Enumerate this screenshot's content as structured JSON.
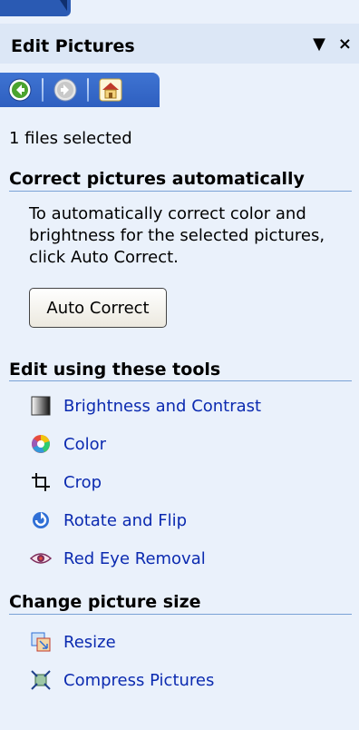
{
  "panel": {
    "title": "Edit Pictures",
    "dropdown_glyph": "▼",
    "close_glyph": "×"
  },
  "nav": {
    "back_icon": "back-arrow-icon",
    "forward_icon": "forward-arrow-icon",
    "home_icon": "home-icon"
  },
  "status": {
    "files_selected": "1 files selected"
  },
  "correct_section": {
    "heading": "Correct pictures automatically",
    "description": "To automatically correct color and brightness for the selected pictures, click Auto Correct.",
    "button_label": "Auto Correct"
  },
  "tools_section": {
    "heading": "Edit using these tools",
    "items": [
      {
        "label": "Brightness and Contrast",
        "icon": "brightness-contrast-icon"
      },
      {
        "label": "Color",
        "icon": "color-wheel-icon"
      },
      {
        "label": "Crop",
        "icon": "crop-icon"
      },
      {
        "label": "Rotate and Flip",
        "icon": "rotate-icon"
      },
      {
        "label": "Red Eye Removal",
        "icon": "eye-icon"
      }
    ]
  },
  "size_section": {
    "heading": "Change picture size",
    "items": [
      {
        "label": "Resize",
        "icon": "resize-icon"
      },
      {
        "label": "Compress Pictures",
        "icon": "compress-icon"
      }
    ]
  },
  "colors": {
    "panel_bg": "#eaf1fb",
    "nav_blue": "#3f74d2",
    "link_blue": "#0b2ab0",
    "rule_blue": "#7aa2d6"
  }
}
